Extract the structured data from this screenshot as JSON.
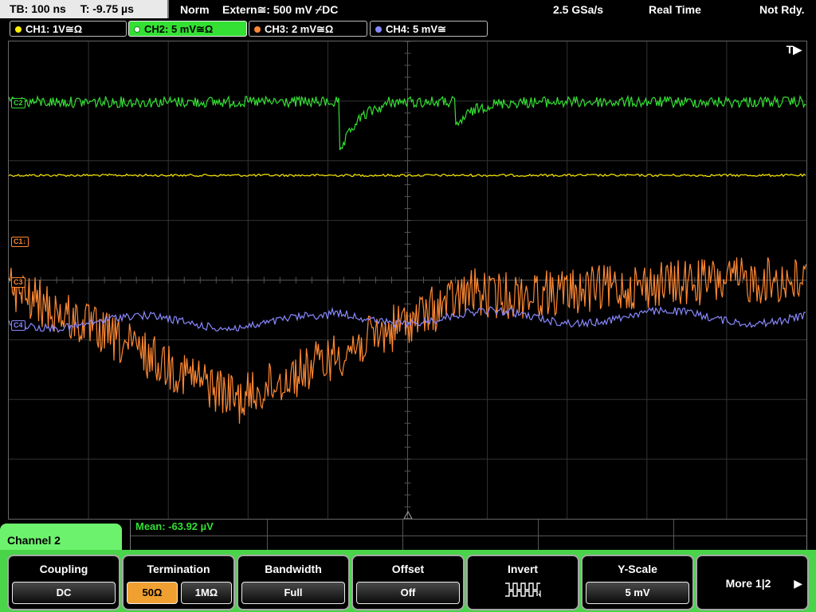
{
  "status": {
    "timebase": "TB: 100 ns",
    "trigger_offset": "T: -9.75 µs",
    "trigger_mode": "Norm",
    "trigger_source": "Extern≅: 500 mV ⌿DC",
    "sample_rate": "2.5 GSa/s",
    "acq_mode": "Real Time",
    "state": "Not Rdy."
  },
  "channels": [
    {
      "label": "CH1: 1V≅Ω",
      "color": "#ffee00"
    },
    {
      "label": "CH2: 5 mV≅Ω",
      "color": "#33e033"
    },
    {
      "label": "CH3: 2 mV≅Ω",
      "color": "#ff8833"
    },
    {
      "label": "CH4: 5 mV≅",
      "color": "#8888ff"
    }
  ],
  "trigger_marker": "T▶",
  "markers": {
    "c1": "C1↓",
    "c2": "C2",
    "c3": "C3",
    "c4": "C4"
  },
  "measurement": {
    "text": "Mean: -63.92 µV"
  },
  "channel_panel": "Channel 2",
  "softkeys": {
    "coupling": {
      "label": "Coupling",
      "value": "DC"
    },
    "termination": {
      "label": "Termination",
      "options": [
        "50Ω",
        "1MΩ"
      ],
      "selected": "50Ω"
    },
    "bandwidth": {
      "label": "Bandwidth",
      "value": "Full"
    },
    "offset": {
      "label": "Offset",
      "value": "Off"
    },
    "invert": {
      "label": "Invert",
      "icon": "invert-square-wave-icon"
    },
    "yscale": {
      "label": "Y-Scale",
      "value": "5 mV"
    },
    "more": {
      "label": "More 1|2"
    }
  }
}
